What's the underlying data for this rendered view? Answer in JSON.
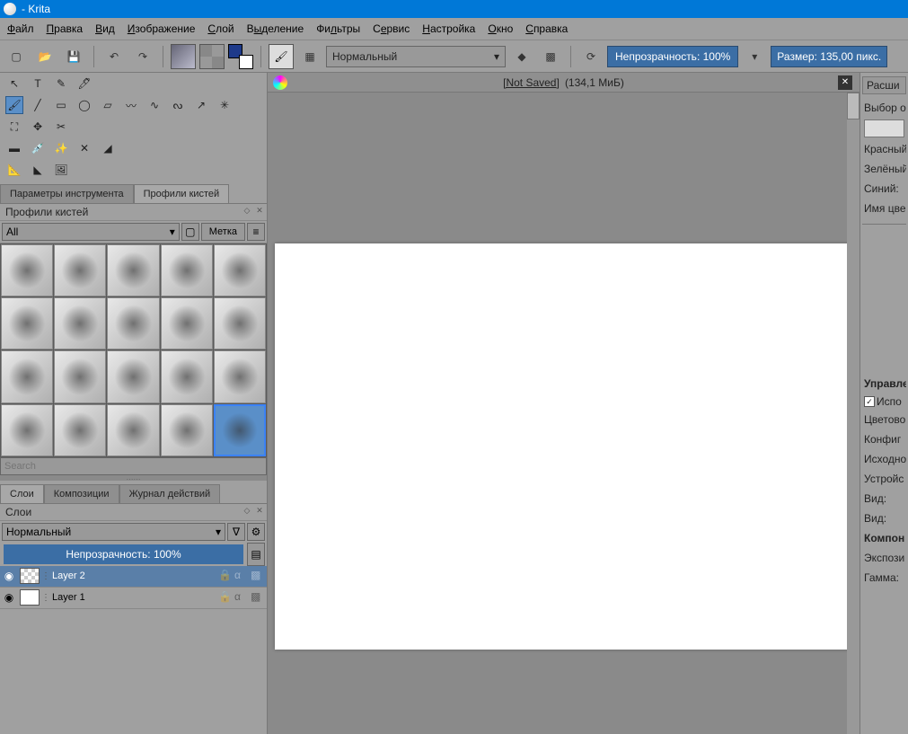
{
  "app": {
    "title": "- Krita"
  },
  "menu": [
    "Файл",
    "Правка",
    "Вид",
    "Изображение",
    "Слой",
    "Выделение",
    "Фильтры",
    "Сервис",
    "Настройка",
    "Окно",
    "Справка"
  ],
  "toolbar": {
    "blend_mode": "Нормальный",
    "opacity": "Непрозрачность: 100%",
    "size": "Размер: 135,00 пикс."
  },
  "doc": {
    "title": "[Not Saved]",
    "info": "(134,1 МиБ)"
  },
  "dockers_top": {
    "tab1": "Параметры инструмента",
    "tab2": "Профили кистей",
    "title": "Профили кистей",
    "filter": "All",
    "tag_btn": "Метка",
    "search_placeholder": "Search"
  },
  "dockers_bottom": {
    "tab1": "Слои",
    "tab2": "Композиции",
    "tab3": "Журнал действий",
    "title": "Слои",
    "blend": "Нормальный",
    "opacity": "Непрозрачность:  100%",
    "layers": [
      {
        "name": "Layer 2",
        "selected": true,
        "transparent": true
      },
      {
        "name": "Layer 1",
        "selected": false,
        "transparent": false
      }
    ]
  },
  "right": {
    "tab": "Расши",
    "color_title": "Выбор о",
    "red": "Красный",
    "green": "Зелёный",
    "blue": "Синий:",
    "name": "Имя цве",
    "manage": "Управле",
    "use_check": "Испо",
    "colorspace": "Цветово",
    "config": "Конфиг",
    "source": "Исходно",
    "device": "Устройс",
    "view1": "Вид:",
    "view2": "Вид:",
    "components": "Компон",
    "exposure": "Экспози",
    "gamma": "Гамма:"
  }
}
